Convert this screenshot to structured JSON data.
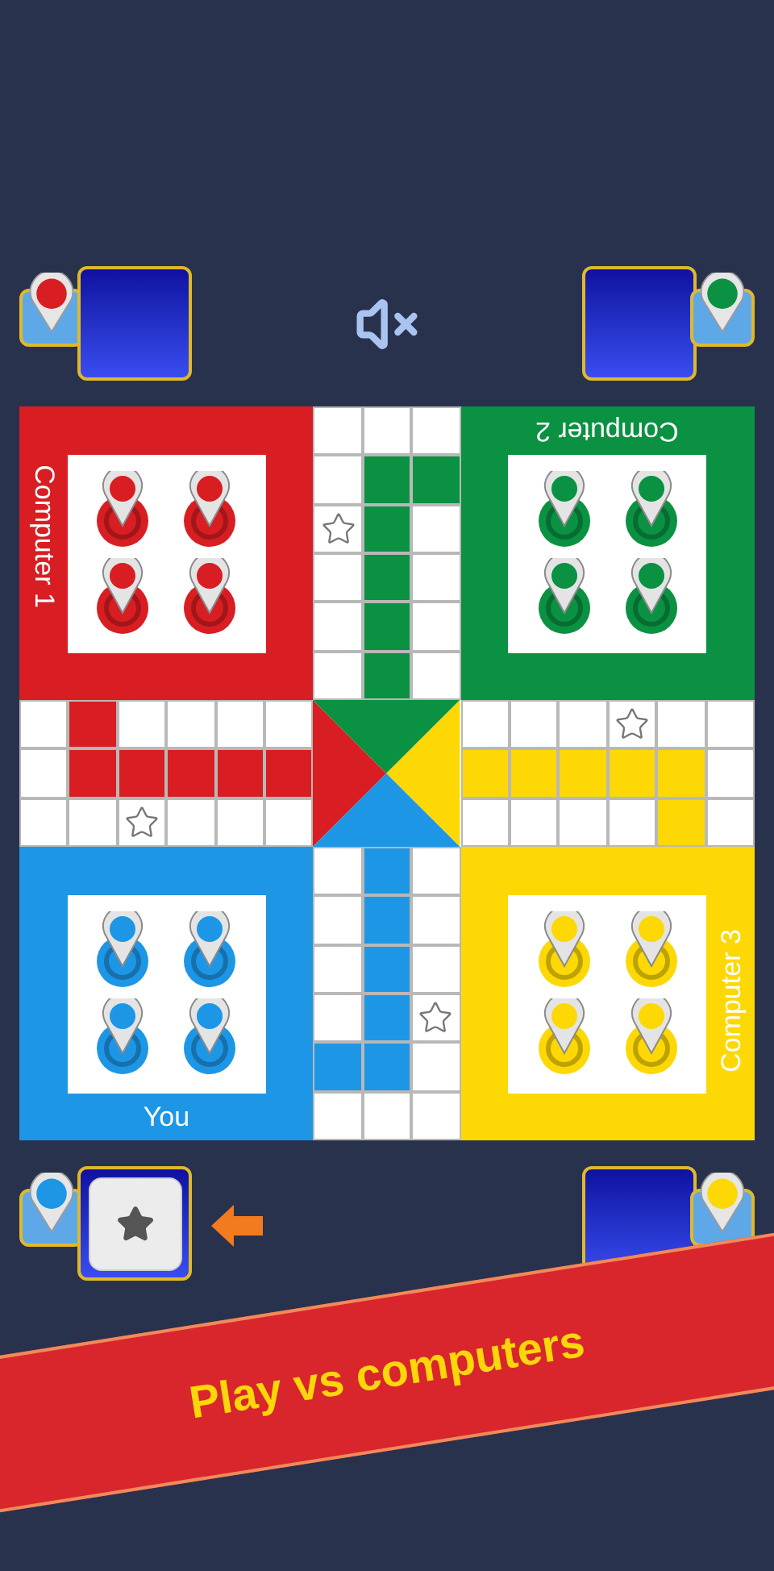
{
  "players": [
    {
      "name": "Computer 1",
      "color": "#d81e22",
      "selected": false
    },
    {
      "name": "Computer 2",
      "color": "#0a9142",
      "selected": false
    },
    {
      "name": "You",
      "color": "#1e96e6",
      "selected": true
    },
    {
      "name": "Computer 3",
      "color": "#fdd804",
      "selected": false
    }
  ],
  "sound": {
    "muted": true
  },
  "banner": {
    "text": "Play vs computers"
  }
}
